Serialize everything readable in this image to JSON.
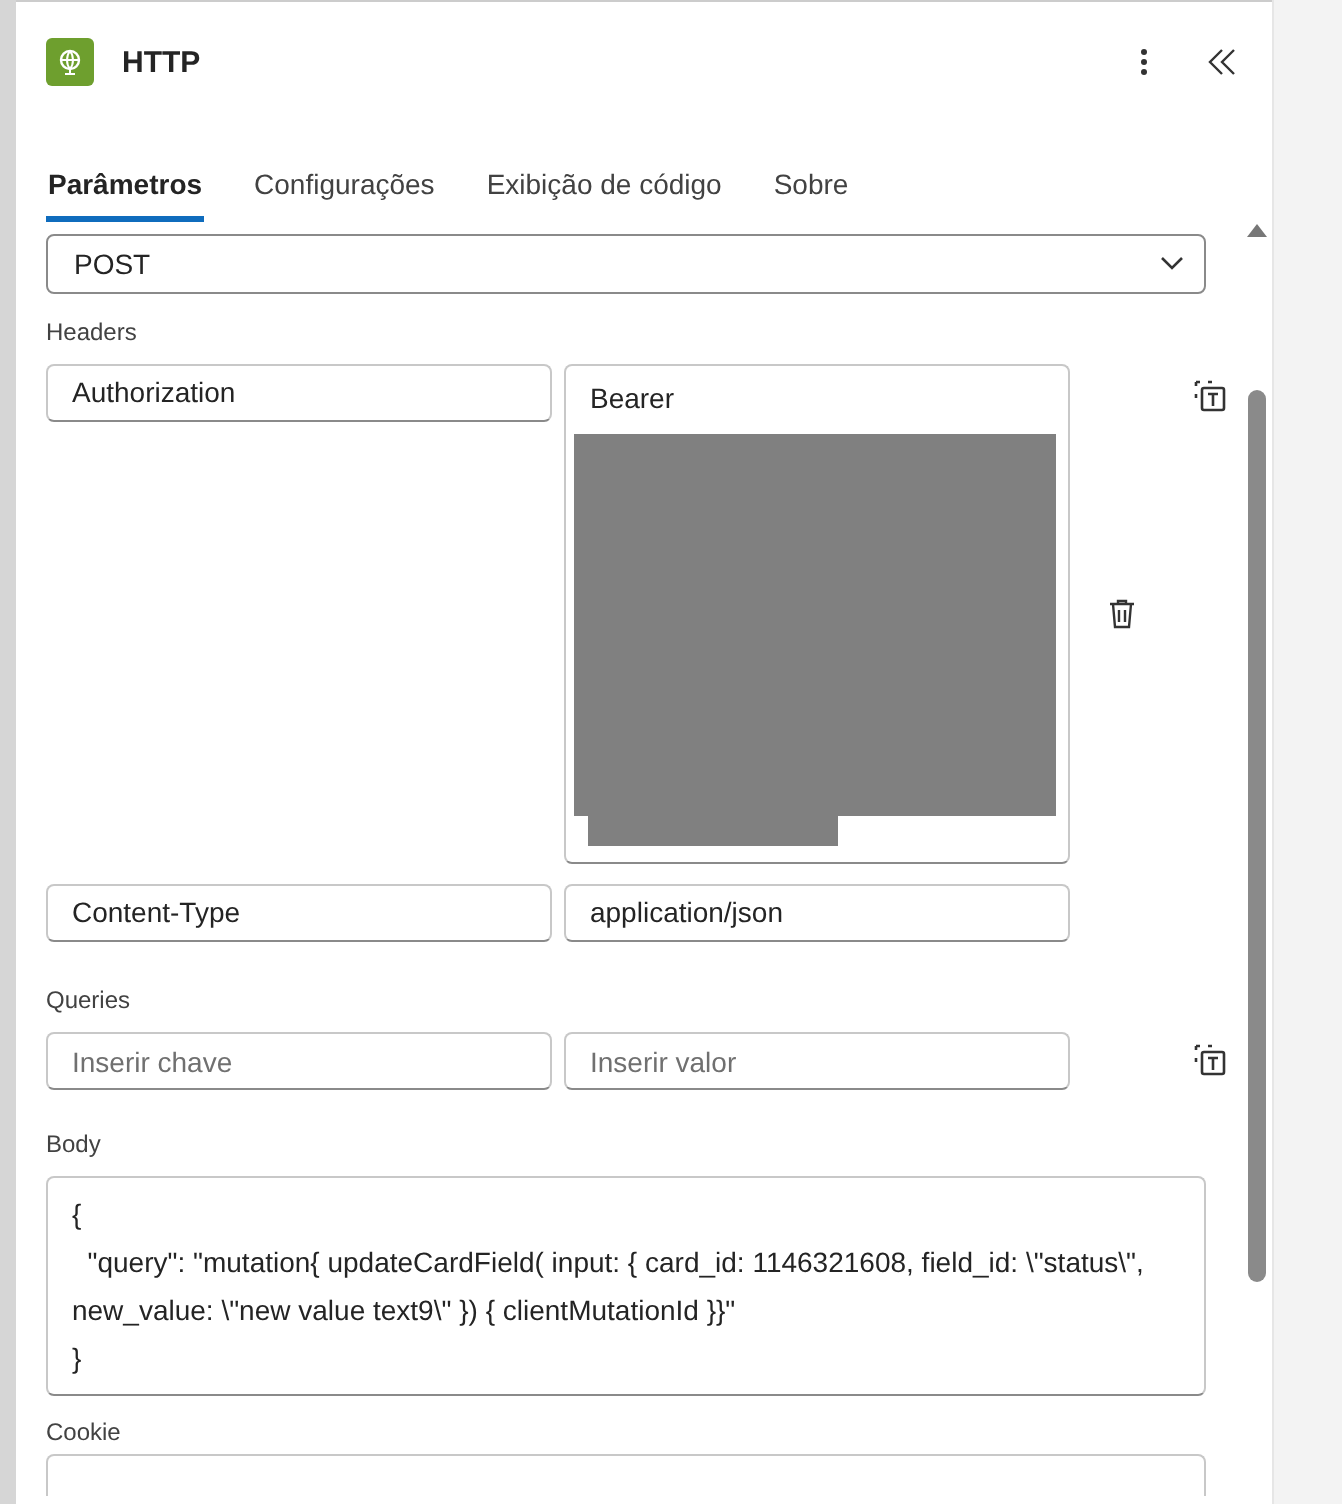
{
  "panel": {
    "title": "HTTP"
  },
  "tabs": [
    {
      "label": "Parâmetros",
      "selected": true
    },
    {
      "label": "Configurações",
      "selected": false
    },
    {
      "label": "Exibição de código",
      "selected": false
    },
    {
      "label": "Sobre",
      "selected": false
    }
  ],
  "method": {
    "value": "POST"
  },
  "headers": {
    "label": "Headers",
    "rows": [
      {
        "key": "Authorization",
        "value": "Bearer",
        "redacted": true
      },
      {
        "key": "Content-Type",
        "value": "application/json",
        "redacted": false
      }
    ]
  },
  "queries": {
    "label": "Queries",
    "key_placeholder": "Inserir chave",
    "value_placeholder": "Inserir valor"
  },
  "body": {
    "label": "Body",
    "lines": [
      "{",
      "  \"query\": \"mutation{ updateCardField( input: { card_id: 1146321608, field_id: \\\"status\\\", new_value: \\\"new value text9\\\" }) { clientMutationId }}\"",
      "}"
    ]
  },
  "cookie": {
    "label": "Cookie"
  }
}
